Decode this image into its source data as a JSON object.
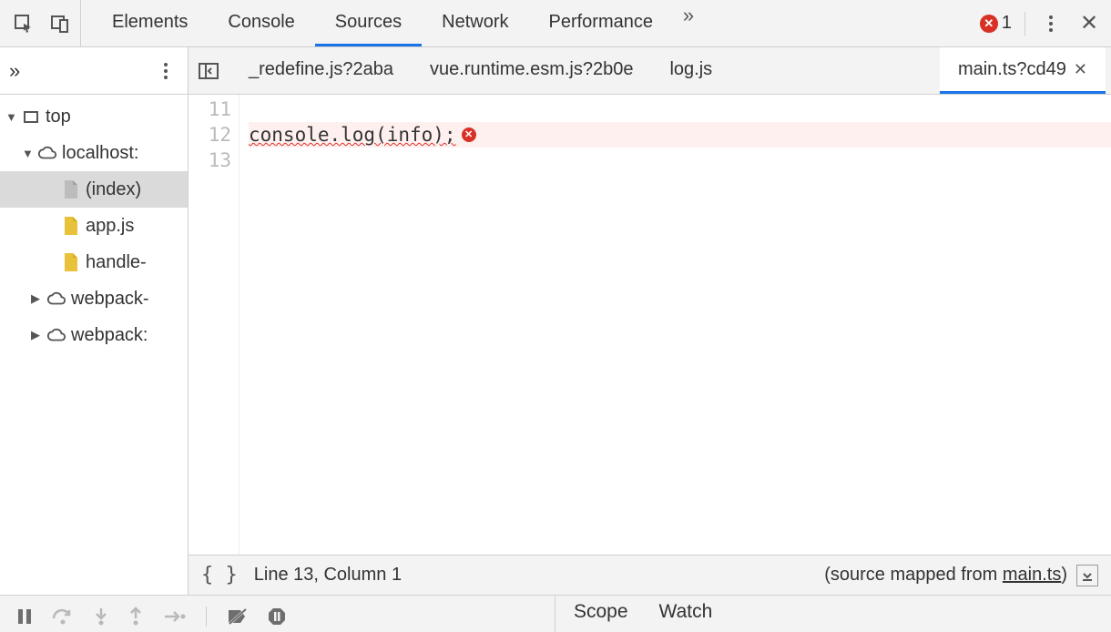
{
  "toolbar": {
    "tabs": [
      "Elements",
      "Console",
      "Sources",
      "Network",
      "Performance"
    ],
    "active_tab_index": 2,
    "error_count": "1"
  },
  "sidebar": {
    "tree": [
      {
        "label": "top",
        "icon": "frame"
      },
      {
        "label": "localhost:",
        "icon": "cloud"
      },
      {
        "label": "(index)",
        "icon": "file"
      },
      {
        "label": "app.js",
        "icon": "jsfile"
      },
      {
        "label": "handle-",
        "icon": "jsfile"
      },
      {
        "label": "webpack-",
        "icon": "cloud"
      },
      {
        "label": "webpack:",
        "icon": "cloud"
      }
    ]
  },
  "file_tabs": {
    "items": [
      "_redefine.js?2aba",
      "vue.runtime.esm.js?2b0e",
      "log.js",
      "main.ts?cd49"
    ],
    "active_index": 3
  },
  "editor": {
    "gutter": [
      "11",
      "12",
      "13"
    ],
    "line12": "console.log(info);"
  },
  "status": {
    "cursor": "Line 13, Column 1",
    "mapped_prefix": "(source mapped from ",
    "mapped_file": "main.ts",
    "mapped_suffix": ")"
  },
  "bottom": {
    "tabs": [
      "Scope",
      "Watch"
    ]
  }
}
